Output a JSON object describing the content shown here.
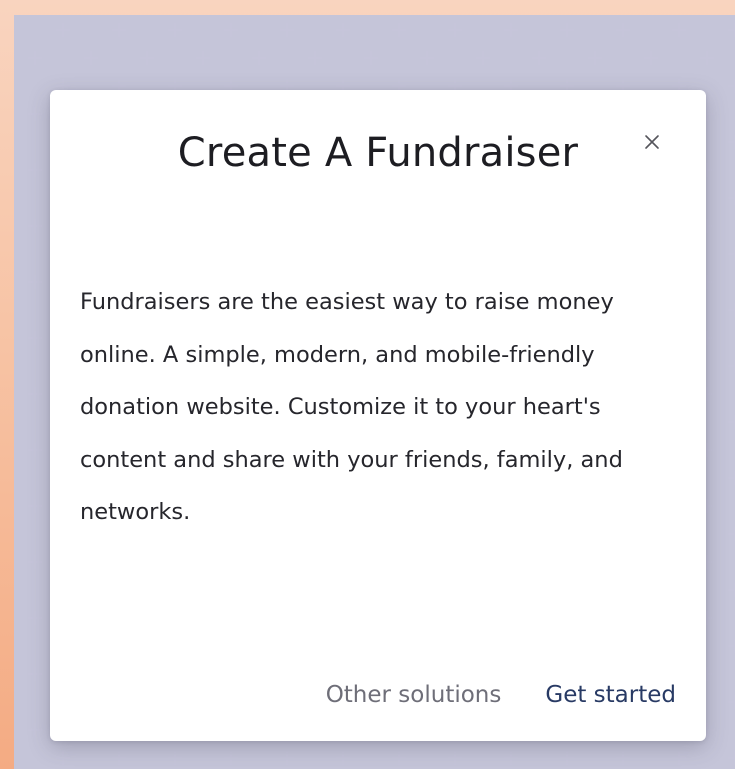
{
  "dialog": {
    "title": "Create A Fundraiser",
    "body": "Fundraisers are the easiest way to raise money online. A simple, modern, and mobile-friendly donation website. Customize it to your heart's content and share with your friends, family, and networks.",
    "close_icon": "close-icon",
    "actions": {
      "secondary_label": "Other solutions",
      "primary_label": "Get started"
    }
  },
  "colors": {
    "background_gradient": [
      "#f9d4bf",
      "#f4ab83"
    ],
    "pattern": "#c6c5da",
    "primary_button": "#283a64",
    "secondary_button": "#6e6e78"
  }
}
